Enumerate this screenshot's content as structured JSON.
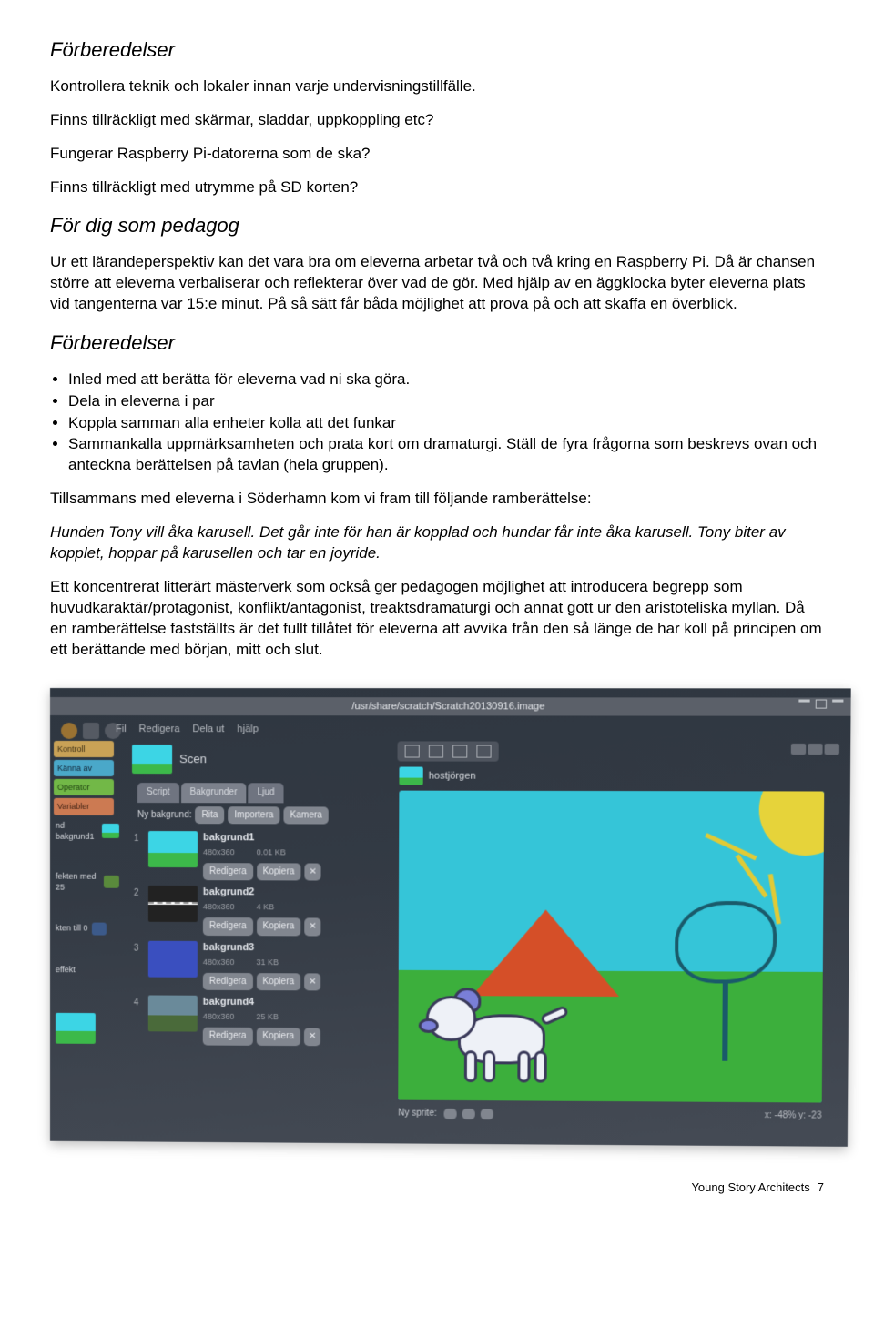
{
  "section1": {
    "heading": "Förberedelser",
    "p1": "Kontrollera teknik och lokaler innan varje undervisningstillfälle.",
    "p2": "Finns tillräckligt med skärmar, sladdar, uppkoppling etc?",
    "p3": "Fungerar Raspberry Pi-datorerna som de ska?",
    "p4": "Finns tillräckligt med utrymme på SD korten?"
  },
  "section2": {
    "heading": "För dig som pedagog",
    "body": "Ur ett lärandeperspektiv kan det vara bra om eleverna arbetar två och två kring en Raspberry Pi. Då är chansen större att eleverna verbaliserar och reflekterar över vad de gör. Med hjälp av en äggklocka byter eleverna plats vid tangenterna var 15:e minut. På så sätt får båda möjlighet att prova på och att skaffa en överblick."
  },
  "section3": {
    "heading": "Förberedelser",
    "items": [
      "Inled med att berätta för eleverna vad ni ska göra.",
      "Dela in eleverna i par",
      "Koppla samman alla enheter kolla att det funkar",
      "Sammankalla uppmärksamheten och prata kort om dramaturgi. Ställ de fyra frågorna som  beskrevs ovan och anteckna berättelsen på tavlan (hela gruppen)."
    ],
    "p_after": "Tillsammans med eleverna i Söderhamn kom vi fram till följande ramberättelse:",
    "story": "Hunden Tony vill åka karusell. Det går inte för han är kopplad och hundar får inte åka karusell. Tony biter av kopplet, hoppar på karusellen och tar en joyride.",
    "conclusion": "Ett koncentrerat litterärt mästerverk som också ger pedagogen möjlighet att introducera begrepp som huvudkaraktär/protagonist, konflikt/antagonist, treaktsdramaturgi och annat gott ur den aristoteliska myllan. Då en ramberättelse fastställts är det fullt tillåtet för eleverna att avvika från den så länge de har koll på principen om ett berättande med början, mitt och slut."
  },
  "scratch": {
    "title_path": "/usr/share/scratch/Scratch20130916.image",
    "menu": {
      "fil": "Fil",
      "redigera": "Redigera",
      "dela": "Dela ut",
      "hjalp": "hjälp"
    },
    "categories": {
      "kontroll": "Kontroll",
      "kanna": "Känna av",
      "operator": "Operator",
      "variabler": "Variabler"
    },
    "palette": [
      {
        "label": "nd bakgrund1"
      },
      {
        "label": "fekten med 25"
      },
      {
        "label": "kten till 0"
      },
      {
        "label": "effekt"
      }
    ],
    "stage_label": "Scen",
    "tabs": {
      "script": "Script",
      "bakgrunder": "Bakgrunder",
      "ljud": "Ljud"
    },
    "new_bg_label": "Ny bakgrund:",
    "new_bg_buttons": {
      "rita": "Rita",
      "importera": "Importera",
      "kamera": "Kamera"
    },
    "bg_actions": {
      "redigera": "Redigera",
      "kopiera": "Kopiera"
    },
    "backgrounds": [
      {
        "num": "1",
        "name": "bakgrund1",
        "dims": "480x360",
        "size": "0.01 KB"
      },
      {
        "num": "2",
        "name": "bakgrund2",
        "dims": "480x360",
        "size": "4 KB"
      },
      {
        "num": "3",
        "name": "bakgrund3",
        "dims": "480x360",
        "size": "31 KB"
      },
      {
        "num": "4",
        "name": "bakgrund4",
        "dims": "480x360",
        "size": "25 KB"
      }
    ],
    "sprite_name": "hostjörgen",
    "new_sprite_label": "Ny sprite:",
    "zoom_info": "x: -48%   y: -23"
  },
  "footer": {
    "title": "Young Story Architects",
    "page": "7"
  }
}
